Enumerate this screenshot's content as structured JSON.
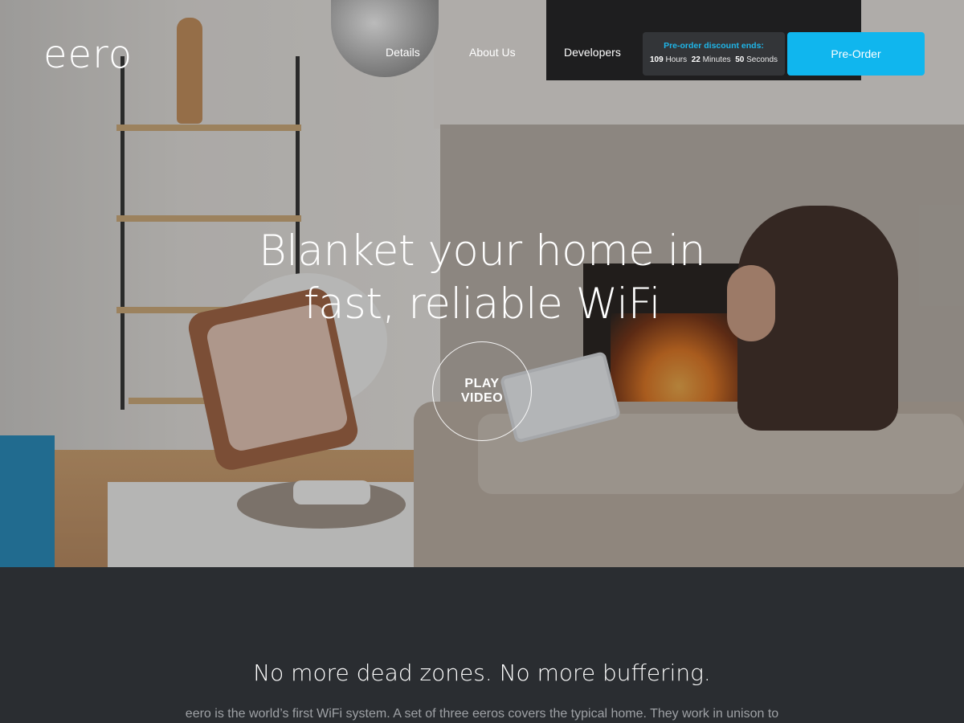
{
  "brand": {
    "logo_text": "eero"
  },
  "nav": {
    "items": [
      {
        "label": "Details"
      },
      {
        "label": "About Us"
      },
      {
        "label": "Developers"
      }
    ],
    "countdown": {
      "title": "Pre-order discount ends:",
      "hours_value": "109",
      "hours_label": "Hours",
      "minutes_value": "22",
      "minutes_label": "Minutes",
      "seconds_value": "50",
      "seconds_label": "Seconds"
    },
    "cta_label": "Pre-Order"
  },
  "hero": {
    "headline_line1": "Blanket your home in",
    "headline_line2": "fast, reliable WiFi",
    "play_line1": "PLAY",
    "play_line2": "VIDEO"
  },
  "section": {
    "heading": "No more dead zones. No more buffering.",
    "body": "eero is the world’s first WiFi system. A set of three eeros covers the typical home. They work in unison to"
  },
  "colors": {
    "accent": "#10b6ee",
    "countdown_title": "#1fb6e9",
    "dark_section": "#2a2d31"
  }
}
